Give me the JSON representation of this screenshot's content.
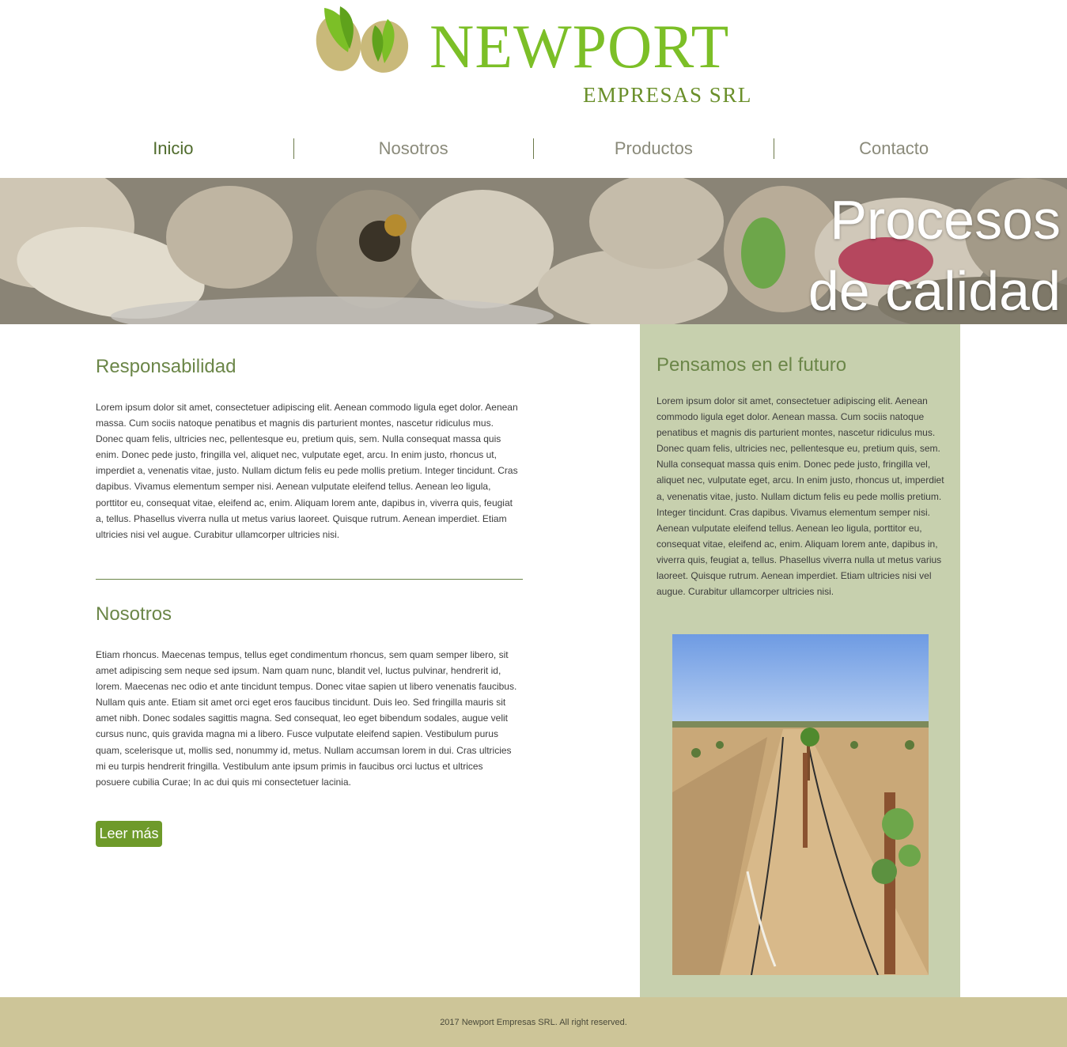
{
  "brand": {
    "name": "NEWPORT",
    "subtitle": "EMPRESAS SRL"
  },
  "nav": {
    "items": [
      {
        "label": "Inicio",
        "active": true
      },
      {
        "label": "Nosotros",
        "active": false
      },
      {
        "label": "Productos",
        "active": false
      },
      {
        "label": "Contacto",
        "active": false
      }
    ]
  },
  "hero": {
    "line1": "Procesos",
    "line2": "de calidad"
  },
  "main": {
    "responsabilidad": {
      "title": "Responsabilidad",
      "text": "Lorem ipsum dolor sit amet, consectetuer adipiscing elit. Aenean commodo ligula eget dolor. Aenean massa. Cum sociis natoque penatibus et magnis dis parturient montes, nascetur ridiculus mus. Donec quam felis, ultricies nec, pellentesque eu, pretium quis, sem. Nulla consequat massa quis enim. Donec pede justo, fringilla vel, aliquet nec, vulputate eget, arcu. In enim justo, rhoncus ut, imperdiet a, venenatis vitae, justo. Nullam dictum felis eu pede mollis pretium. Integer tincidunt. Cras dapibus. Vivamus elementum semper nisi. Aenean vulputate eleifend tellus. Aenean leo ligula, porttitor eu, consequat vitae, eleifend ac, enim. Aliquam lorem ante, dapibus in, viverra quis, feugiat a, tellus. Phasellus viverra nulla ut metus varius laoreet. Quisque rutrum. Aenean imperdiet. Etiam ultricies nisi vel augue. Curabitur ullamcorper ultricies nisi."
    },
    "nosotros": {
      "title": "Nosotros",
      "text": "Etiam rhoncus. Maecenas tempus, tellus eget condimentum rhoncus, sem quam semper libero, sit amet adipiscing sem neque sed ipsum. Nam quam nunc, blandit vel, luctus pulvinar, hendrerit id, lorem. Maecenas nec odio et ante tincidunt tempus. Donec vitae sapien ut libero venenatis faucibus. Nullam quis ante. Etiam sit amet orci eget eros faucibus tincidunt. Duis leo. Sed fringilla mauris sit amet nibh. Donec sodales sagittis magna. Sed consequat, leo eget bibendum sodales, augue velit cursus nunc, quis gravida magna mi a libero. Fusce vulputate eleifend sapien. Vestibulum purus quam, scelerisque ut, mollis sed, nonummy id, metus. Nullam accumsan lorem in dui. Cras ultricies mi eu turpis hendrerit fringilla. Vestibulum ante ipsum primis in faucibus orci luctus et ultrices posuere cubilia Curae; In ac dui quis mi consectetuer lacinia.",
      "button": "Leer más"
    }
  },
  "sidebar": {
    "title": "Pensamos en el futuro",
    "text": "Lorem ipsum dolor sit amet, consectetuer adipiscing elit. Aenean commodo ligula eget dolor. Aenean massa. Cum sociis natoque penatibus et magnis dis parturient montes, nascetur ridiculus mus. Donec quam felis, ultricies nec, pellentesque eu, pretium quis, sem. Nulla consequat massa quis enim. Donec pede justo, fringilla vel, aliquet nec, vulputate eget, arcu. In enim justo, rhoncus ut, imperdiet a, venenatis vitae, justo. Nullam dictum felis eu pede mollis pretium. Integer tincidunt. Cras dapibus. Vivamus elementum semper nisi. Aenean vulputate eleifend tellus. Aenean leo ligula, porttitor eu, consequat vitae, eleifend ac, enim. Aliquam lorem ante, dapibus in, viverra quis, feugiat a, tellus. Phasellus viverra nulla ut metus varius laoreet. Quisque rutrum. Aenean imperdiet. Etiam ultricies nisi vel augue. Curabitur ullamcorper ultricies nisi."
  },
  "footer": {
    "text": "2017 Newport Empresas SRL. All right reserved."
  },
  "colors": {
    "brand_green": "#7cbf27",
    "dark_green": "#6b8648",
    "sidebar_bg": "#c7d0ae",
    "footer_bg": "#cdc598",
    "button_bg": "#6e9a2a"
  }
}
